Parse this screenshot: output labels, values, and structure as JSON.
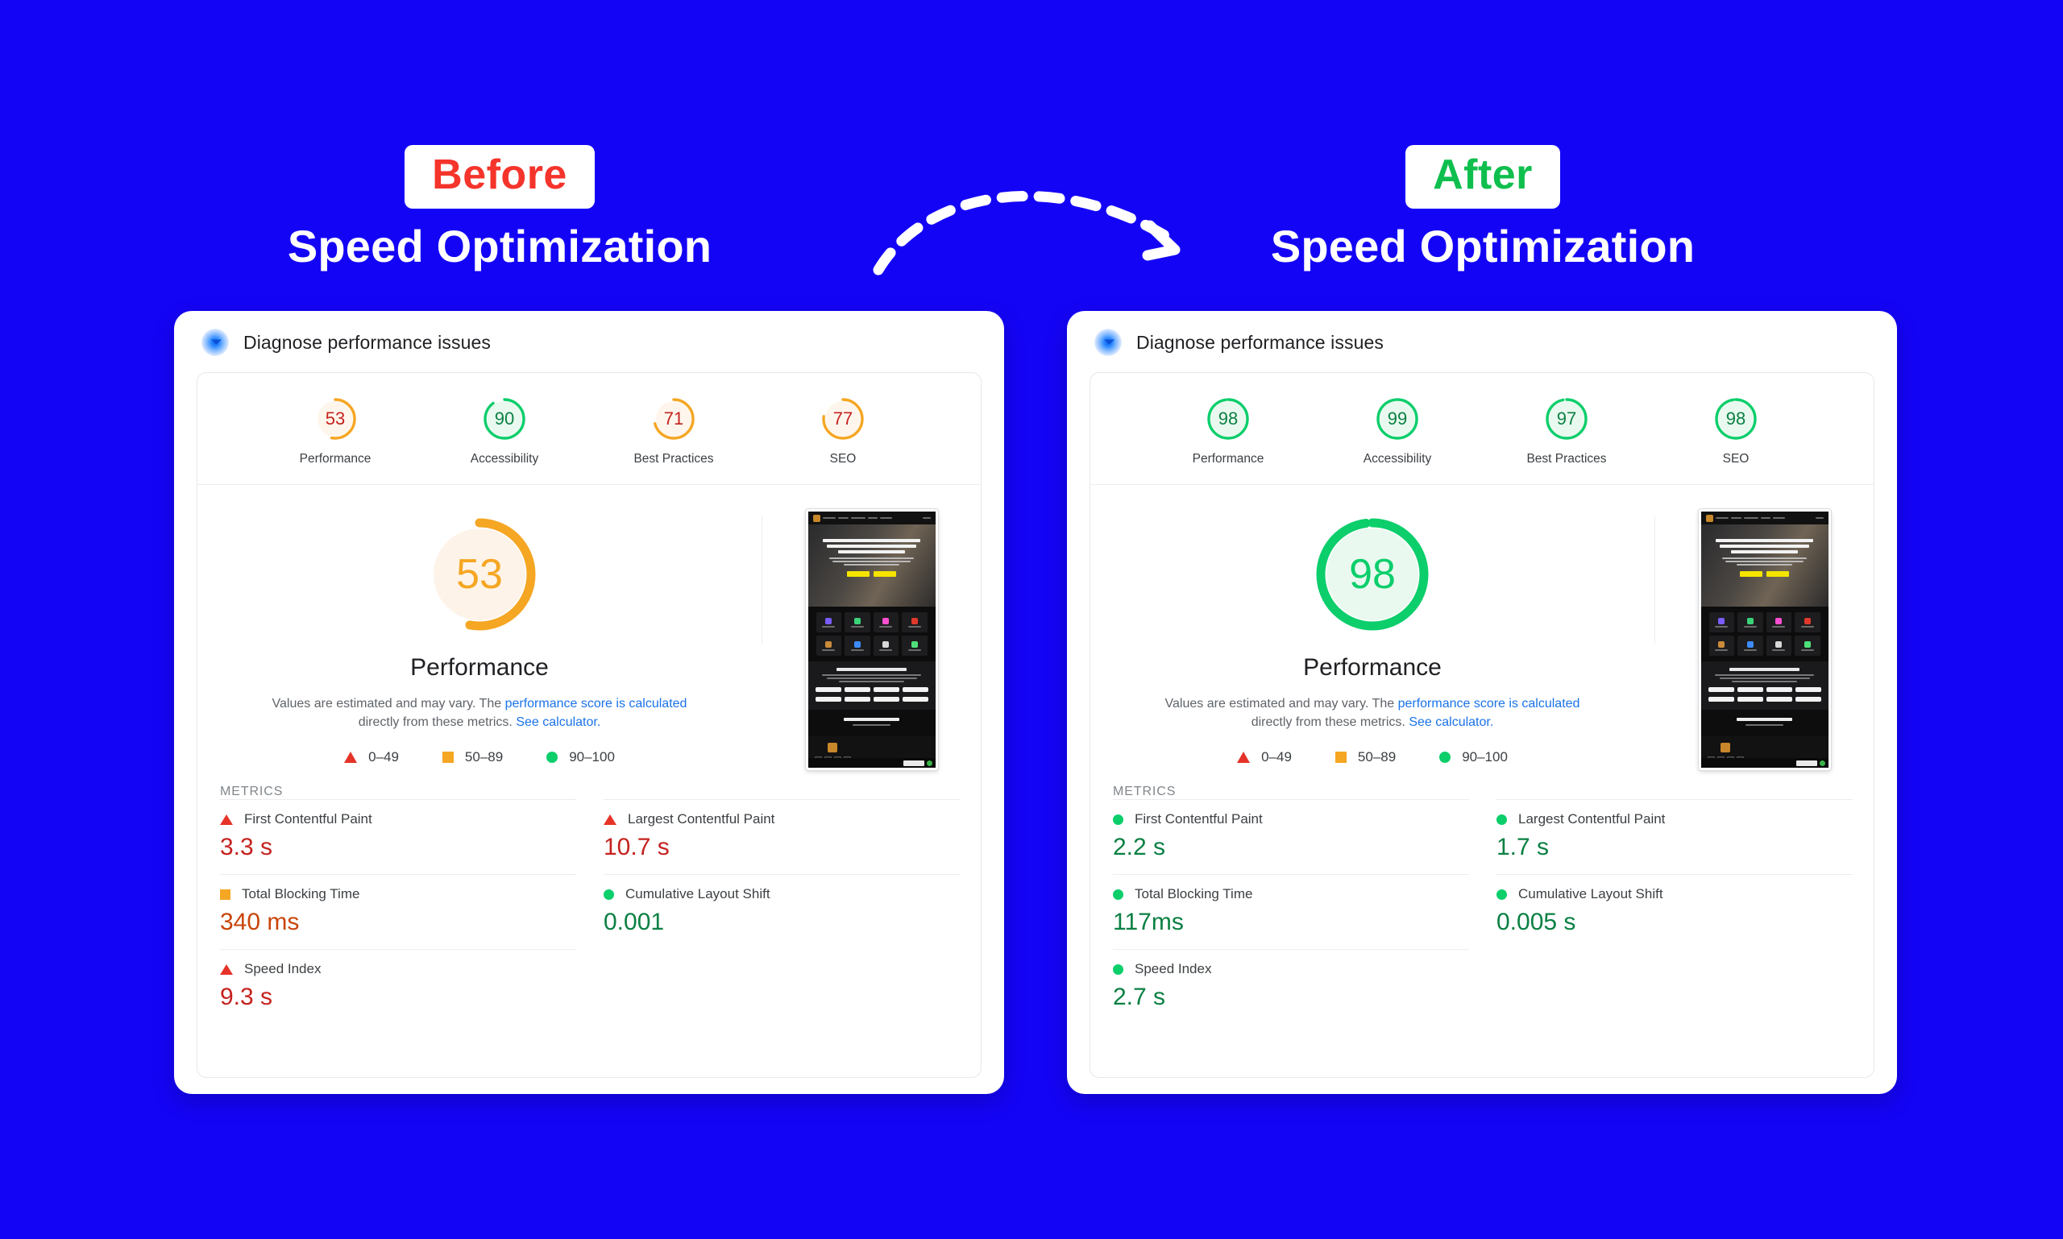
{
  "theme": {
    "background": "#1404F5",
    "card_bg": "#ffffff",
    "red": "#C5221F",
    "orange": "#E8710A",
    "green": "#0B8043",
    "score_red": "#E63329",
    "score_orange": "#F5A623",
    "score_green": "#0CCE6B",
    "link": "#1a73e8"
  },
  "headings": {
    "before": {
      "badge": "Before",
      "badge_color": "#F5342B",
      "subtitle": "Speed Optimization"
    },
    "after": {
      "badge": "After",
      "badge_color": "#0FBF4E",
      "subtitle": "Speed Optimization"
    }
  },
  "arrow": {
    "name": "curved-dashed-arrow",
    "direction": "left-to-right"
  },
  "cards": [
    {
      "id": "before",
      "header_title": "Diagnose performance issues",
      "header_icon": "lighthouse-gauge-icon",
      "scores": [
        {
          "label": "Performance",
          "value": 53,
          "color": "#F5A623",
          "band": "50-89"
        },
        {
          "label": "Accessibility",
          "value": 90,
          "color": "#0CCE6B",
          "band": "90-100"
        },
        {
          "label": "Best Practices",
          "value": 71,
          "color": "#F5A623",
          "band": "50-89"
        },
        {
          "label": "SEO",
          "value": 77,
          "color": "#F5A623",
          "band": "50-89"
        }
      ],
      "main": {
        "score": 53,
        "color": "#F5A623",
        "title": "Performance",
        "note_part1": "Values are estimated and may vary. The ",
        "note_link1": "performance score is calculated",
        "note_part2": " directly from these metrics. ",
        "note_link2": "See calculator."
      },
      "legend": [
        {
          "icon": "triangle",
          "label": "0–49",
          "color": "#E63329"
        },
        {
          "icon": "square",
          "label": "50–89",
          "color": "#F5A623"
        },
        {
          "icon": "circle",
          "label": "90–100",
          "color": "#0CCE6B"
        }
      ],
      "metrics_label": "METRICS",
      "metrics_left": [
        {
          "name": "First Contentful Paint",
          "value": "3.3 s",
          "icon": "triangle",
          "icon_color": "#E63329",
          "value_color": "#C5221F"
        },
        {
          "name": "Total Blocking Time",
          "value": "340 ms",
          "icon": "square",
          "icon_color": "#F5A623",
          "value_color": "#C9450B"
        },
        {
          "name": "Speed Index",
          "value": "9.3 s",
          "icon": "triangle",
          "icon_color": "#E63329",
          "value_color": "#C5221F"
        }
      ],
      "metrics_right": [
        {
          "name": "Largest Contentful Paint",
          "value": "10.7 s",
          "icon": "triangle",
          "icon_color": "#E63329",
          "value_color": "#C5221F"
        },
        {
          "name": "Cumulative Layout Shift",
          "value": "0.001",
          "icon": "circle",
          "icon_color": "#0CCE6B",
          "value_color": "#0B8043"
        }
      ]
    },
    {
      "id": "after",
      "header_title": "Diagnose performance issues",
      "header_icon": "lighthouse-gauge-icon",
      "scores": [
        {
          "label": "Performance",
          "value": 98,
          "color": "#0CCE6B",
          "band": "90-100"
        },
        {
          "label": "Accessibility",
          "value": 99,
          "color": "#0CCE6B",
          "band": "90-100"
        },
        {
          "label": "Best Practices",
          "value": 97,
          "color": "#0CCE6B",
          "band": "90-100"
        },
        {
          "label": "SEO",
          "value": 98,
          "color": "#0CCE6B",
          "band": "90-100"
        }
      ],
      "main": {
        "score": 98,
        "color": "#0CCE6B",
        "title": "Performance",
        "note_part1": "Values are estimated and may vary. The ",
        "note_link1": "performance score is calculated",
        "note_part2": " directly from these metrics. ",
        "note_link2": "See calculator."
      },
      "legend": [
        {
          "icon": "triangle",
          "label": "0–49",
          "color": "#E63329"
        },
        {
          "icon": "square",
          "label": "50–89",
          "color": "#F5A623"
        },
        {
          "icon": "circle",
          "label": "90–100",
          "color": "#0CCE6B"
        }
      ],
      "metrics_label": "METRICS",
      "metrics_left": [
        {
          "name": "First Contentful Paint",
          "value": "2.2 s",
          "icon": "circle",
          "icon_color": "#0CCE6B",
          "value_color": "#0B8043"
        },
        {
          "name": "Total Blocking Time",
          "value": "117ms",
          "icon": "circle",
          "icon_color": "#0CCE6B",
          "value_color": "#0B8043"
        },
        {
          "name": "Speed Index",
          "value": "2.7 s",
          "icon": "circle",
          "icon_color": "#0CCE6B",
          "value_color": "#0B8043"
        }
      ],
      "metrics_right": [
        {
          "name": "Largest Contentful Paint",
          "value": "1.7 s",
          "icon": "circle",
          "icon_color": "#0CCE6B",
          "value_color": "#0B8043"
        },
        {
          "name": "Cumulative Layout Shift",
          "value": "0.005 s",
          "icon": "circle",
          "icon_color": "#0CCE6B",
          "value_color": "#0B8043"
        }
      ]
    }
  ],
  "thumbnail": {
    "name": "page-screenshot-thumbnail",
    "description": "dark e-commerce landing page preview"
  }
}
